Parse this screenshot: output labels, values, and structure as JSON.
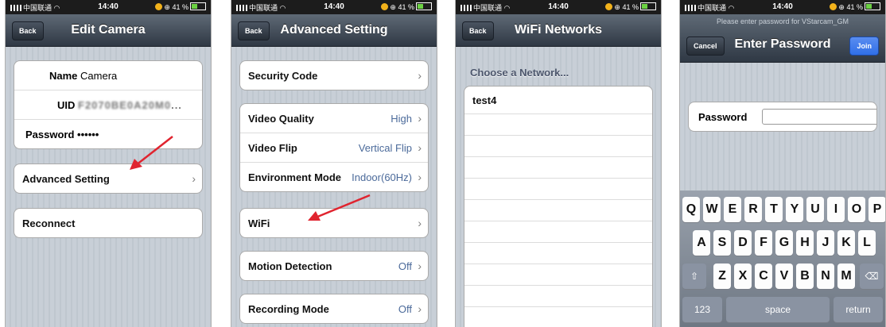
{
  "status": {
    "carrier": "中国联通",
    "time": "14:40",
    "battery": "41 %"
  },
  "screen1": {
    "back": "Back",
    "title": "Edit Camera",
    "name_label": "Name",
    "name_value": "Camera",
    "uid_label": "UID",
    "uid_value": "F...",
    "password_label": "Password",
    "password_value": "••••••",
    "advanced": "Advanced Setting",
    "reconnect": "Reconnect"
  },
  "screen2": {
    "back": "Back",
    "title": "Advanced Setting",
    "security": "Security Code",
    "video_quality": "Video Quality",
    "video_quality_value": "High",
    "video_flip": "Video Flip",
    "video_flip_value": "Vertical Flip",
    "env_mode": "Environment Mode",
    "env_mode_value": "Indoor(60Hz)",
    "wifi": "WiFi",
    "motion": "Motion Detection",
    "motion_value": "Off",
    "recording": "Recording Mode",
    "recording_value": "Off"
  },
  "screen3": {
    "back": "Back",
    "title": "WiFi Networks",
    "header": "Choose a Network...",
    "network": "test4"
  },
  "screen4": {
    "prompt": "Please enter password for VStarcam_GM",
    "cancel": "Cancel",
    "title": "Enter Password",
    "join": "Join",
    "password_label": "Password",
    "keys_row1": [
      "Q",
      "W",
      "E",
      "R",
      "T",
      "Y",
      "U",
      "I",
      "O",
      "P"
    ],
    "keys_row2": [
      "A",
      "S",
      "D",
      "F",
      "G",
      "H",
      "J",
      "K",
      "L"
    ],
    "keys_row3": [
      "Z",
      "X",
      "C",
      "V",
      "B",
      "N",
      "M"
    ],
    "key_123": "123",
    "key_space": "space",
    "key_return": "return"
  },
  "colors": {
    "arrow": "#e0242f",
    "nav_dark": "#2f3844",
    "value_blue": "#4b6a9a",
    "join_blue": "#2f6fe8"
  }
}
